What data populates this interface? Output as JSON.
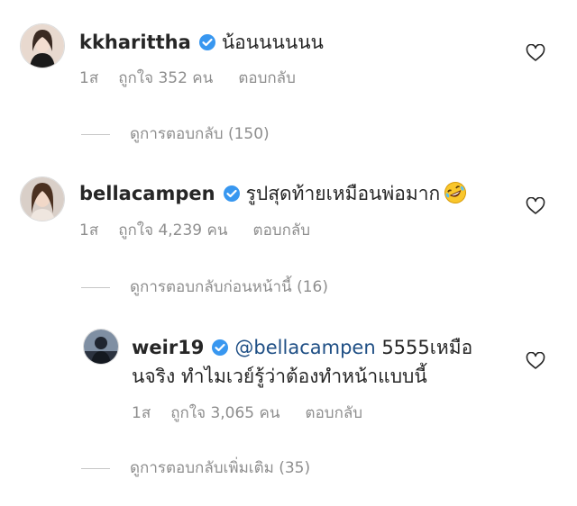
{
  "comments": [
    {
      "username": "kkharittha",
      "text": "น้อนนนนนน",
      "time": "1ส",
      "likes": "ถูกใจ 352 คน",
      "reply": "ตอบกลับ",
      "view_replies": "ดูการตอบกลับ (150)"
    },
    {
      "username": "bellacampen",
      "text": "รูปสุดท้ายเหมือนพ่อมาก",
      "emoji": "rolling-on-floor-laughing",
      "time": "1ส",
      "likes": "ถูกใจ 4,239 คน",
      "reply": "ตอบกลับ",
      "view_replies": "ดูการตอบกลับก่อนหน้านี้ (16)"
    }
  ],
  "reply": {
    "username": "weir19",
    "mention": "@bellacampen",
    "text_line1": " 5555เหมือ",
    "text_line2": "นจริง ทำไมเวย์รู้ว่าต้องทำหน้าแบบนี้",
    "time": "1ส",
    "likes": "ถูกใจ 3,065 คน",
    "reply": "ตอบกลับ",
    "view_replies": "ดูการตอบกลับเพิ่มเติม (35)"
  },
  "colors": {
    "verified": "#3897f0",
    "muted": "#8e8e8e",
    "mention": "#1f4f85"
  }
}
